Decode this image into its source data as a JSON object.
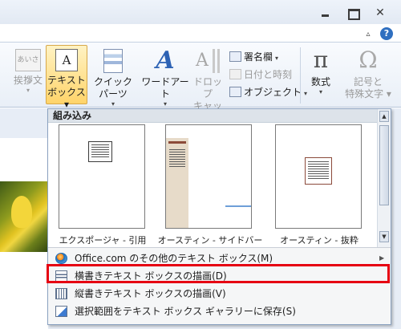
{
  "window": {
    "minimize_label": "",
    "maximize_label": "",
    "close_label": "✕",
    "ribbon_minimize_label": "▵",
    "help_label": "?"
  },
  "ribbon": {
    "greeting": {
      "icon_text": "あいさつ",
      "label": "挨拶文",
      "arrow": "▾"
    },
    "text_box": {
      "icon_text": "A",
      "line1": "テキスト",
      "line2": "ボックス",
      "arrow": "▾"
    },
    "quick_parts": {
      "label": "クイック パーツ",
      "arrow": "▾"
    },
    "wordart": {
      "icon_text": "A",
      "label": "ワードアート",
      "arrow": "▾"
    },
    "drop_cap": {
      "icon_text": "A",
      "line1": "ドロップ",
      "line2": "キャップ",
      "arrow": "▾"
    },
    "signature_line": {
      "label": "署名欄",
      "arrow": "▾"
    },
    "date_time": {
      "label": "日付と時刻"
    },
    "object": {
      "label": "オブジェクト",
      "arrow": "▾"
    },
    "equation": {
      "icon_text": "π",
      "label": "数式",
      "arrow": "▾"
    },
    "symbol": {
      "icon_text": "Ω",
      "line1": "記号と",
      "line2": "特殊文字",
      "arrow": "▾"
    }
  },
  "gallery": {
    "header": "組み込み",
    "scroll_up": "▲",
    "scroll_down": "▼",
    "thumbnails": [
      {
        "label": "エクスポージャ - 引用"
      },
      {
        "label": "オースティン - サイドバー"
      },
      {
        "label": "オースティン - 抜粋"
      }
    ]
  },
  "menu": {
    "items": [
      {
        "label": "Office.com のその他のテキスト ボックス(M)",
        "submenu_arrow": "▶"
      },
      {
        "label": "横書きテキスト ボックスの描画(D)"
      },
      {
        "label": "縦書きテキスト ボックスの描画(V)"
      },
      {
        "label": "選択範囲をテキスト ボックス ギャラリーに保存(S)"
      }
    ]
  },
  "colors": {
    "highlight": "#e60012",
    "ribbon_active": "#ffd46a",
    "gallery_header": "#dde3ea"
  }
}
